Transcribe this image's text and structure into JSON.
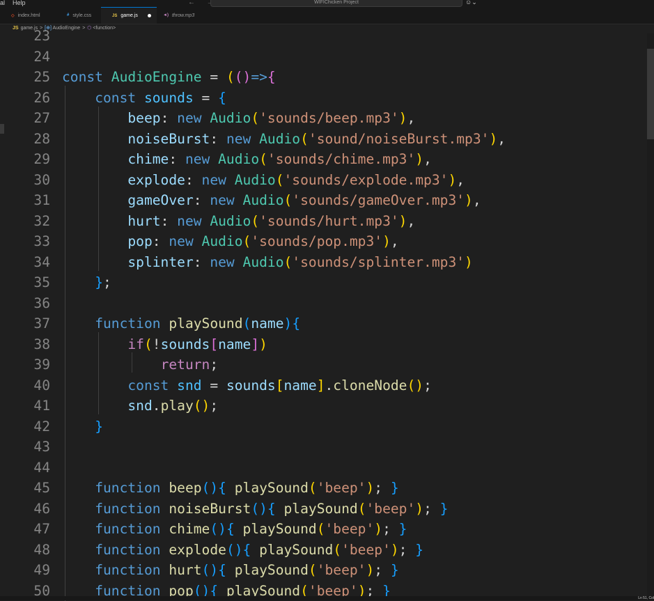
{
  "menubar": {
    "items": [
      "al",
      "Help"
    ],
    "back": "←",
    "forward": "→"
  },
  "command_center": {
    "label": "WIFIChicken Project"
  },
  "tabs": [
    {
      "icon": "html-icon",
      "icon_glyph": "◇",
      "label": "index.html",
      "color": "#e44d26",
      "active": false
    },
    {
      "icon": "css-icon",
      "icon_glyph": "#",
      "label": "style.css",
      "color": "#42a5f5",
      "active": false
    },
    {
      "icon": "js-icon",
      "icon_glyph": "JS",
      "label": "game.js",
      "color": "#e8c64a",
      "active": true,
      "modified": true
    },
    {
      "icon": "audio-icon",
      "icon_glyph": "◄)",
      "label": "throw.mp3",
      "color": "#c586c0",
      "active": false
    }
  ],
  "breadcrumb": {
    "file": "game.js",
    "symbol": "AudioEngine",
    "scope": "<function>"
  },
  "editor": {
    "lines": [
      {
        "n": "23",
        "t": []
      },
      {
        "n": "24",
        "t": []
      },
      {
        "n": "25",
        "t": [
          [
            "k",
            "const "
          ],
          [
            "cls",
            "AudioEngine "
          ],
          [
            "p",
            "= "
          ],
          [
            "b1",
            "("
          ],
          [
            "b2",
            "("
          ],
          [
            "b2",
            ")"
          ],
          [
            "k",
            "=>"
          ],
          [
            "b2",
            "{"
          ]
        ]
      },
      {
        "n": "26",
        "t": [
          [
            "p",
            "    "
          ],
          [
            "k",
            "const "
          ],
          [
            "o",
            "sounds "
          ],
          [
            "p",
            "= "
          ],
          [
            "b3",
            "{"
          ]
        ]
      },
      {
        "n": "27",
        "t": [
          [
            "p",
            "        "
          ],
          [
            "v",
            "beep"
          ],
          [
            "p",
            ": "
          ],
          [
            "k",
            "new "
          ],
          [
            "cls",
            "Audio"
          ],
          [
            "b1",
            "("
          ],
          [
            "s",
            "'sounds/beep.mp3'"
          ],
          [
            "b1",
            ")"
          ],
          [
            "p",
            ","
          ]
        ]
      },
      {
        "n": "28",
        "t": [
          [
            "p",
            "        "
          ],
          [
            "v",
            "noiseBurst"
          ],
          [
            "p",
            ": "
          ],
          [
            "k",
            "new "
          ],
          [
            "cls",
            "Audio"
          ],
          [
            "b1",
            "("
          ],
          [
            "s",
            "'sound/noiseBurst.mp3'"
          ],
          [
            "b1",
            ")"
          ],
          [
            "p",
            ","
          ]
        ]
      },
      {
        "n": "29",
        "t": [
          [
            "p",
            "        "
          ],
          [
            "v",
            "chime"
          ],
          [
            "p",
            ": "
          ],
          [
            "k",
            "new "
          ],
          [
            "cls",
            "Audio"
          ],
          [
            "b1",
            "("
          ],
          [
            "s",
            "'sounds/chime.mp3'"
          ],
          [
            "b1",
            ")"
          ],
          [
            "p",
            ","
          ]
        ]
      },
      {
        "n": "30",
        "t": [
          [
            "p",
            "        "
          ],
          [
            "v",
            "explode"
          ],
          [
            "p",
            ": "
          ],
          [
            "k",
            "new "
          ],
          [
            "cls",
            "Audio"
          ],
          [
            "b1",
            "("
          ],
          [
            "s",
            "'sounds/explode.mp3'"
          ],
          [
            "b1",
            ")"
          ],
          [
            "p",
            ","
          ]
        ]
      },
      {
        "n": "31",
        "t": [
          [
            "p",
            "        "
          ],
          [
            "v",
            "gameOver"
          ],
          [
            "p",
            ": "
          ],
          [
            "k",
            "new "
          ],
          [
            "cls",
            "Audio"
          ],
          [
            "b1",
            "("
          ],
          [
            "s",
            "'sounds/gameOver.mp3'"
          ],
          [
            "b1",
            ")"
          ],
          [
            "p",
            ","
          ]
        ]
      },
      {
        "n": "32",
        "t": [
          [
            "p",
            "        "
          ],
          [
            "v",
            "hurt"
          ],
          [
            "p",
            ": "
          ],
          [
            "k",
            "new "
          ],
          [
            "cls",
            "Audio"
          ],
          [
            "b1",
            "("
          ],
          [
            "s",
            "'sounds/hurt.mp3'"
          ],
          [
            "b1",
            ")"
          ],
          [
            "p",
            ","
          ]
        ]
      },
      {
        "n": "33",
        "t": [
          [
            "p",
            "        "
          ],
          [
            "v",
            "pop"
          ],
          [
            "p",
            ": "
          ],
          [
            "k",
            "new "
          ],
          [
            "cls",
            "Audio"
          ],
          [
            "b1",
            "("
          ],
          [
            "s",
            "'sounds/pop.mp3'"
          ],
          [
            "b1",
            ")"
          ],
          [
            "p",
            ","
          ]
        ]
      },
      {
        "n": "34",
        "t": [
          [
            "p",
            "        "
          ],
          [
            "v",
            "splinter"
          ],
          [
            "p",
            ": "
          ],
          [
            "k",
            "new "
          ],
          [
            "cls",
            "Audio"
          ],
          [
            "b1",
            "("
          ],
          [
            "s",
            "'sounds/splinter.mp3'"
          ],
          [
            "b1",
            ")"
          ]
        ]
      },
      {
        "n": "35",
        "t": [
          [
            "p",
            "    "
          ],
          [
            "b3",
            "}"
          ],
          [
            "p",
            ";"
          ]
        ]
      },
      {
        "n": "36",
        "t": []
      },
      {
        "n": "37",
        "t": [
          [
            "p",
            "    "
          ],
          [
            "k",
            "function "
          ],
          [
            "f",
            "playSound"
          ],
          [
            "b3",
            "("
          ],
          [
            "v",
            "name"
          ],
          [
            "b3",
            ")"
          ],
          [
            "b3",
            "{"
          ]
        ]
      },
      {
        "n": "38",
        "t": [
          [
            "p",
            "        "
          ],
          [
            "c",
            "if"
          ],
          [
            "b1",
            "("
          ],
          [
            "p",
            "!"
          ],
          [
            "v",
            "sounds"
          ],
          [
            "b2",
            "["
          ],
          [
            "v",
            "name"
          ],
          [
            "b2",
            "]"
          ],
          [
            "b1",
            ")"
          ]
        ]
      },
      {
        "n": "39",
        "t": [
          [
            "p",
            "            "
          ],
          [
            "c",
            "return"
          ],
          [
            "p",
            ";"
          ]
        ]
      },
      {
        "n": "40",
        "t": [
          [
            "p",
            "        "
          ],
          [
            "k",
            "const "
          ],
          [
            "o",
            "snd "
          ],
          [
            "p",
            "= "
          ],
          [
            "v",
            "sounds"
          ],
          [
            "b1",
            "["
          ],
          [
            "v",
            "name"
          ],
          [
            "b1",
            "]"
          ],
          [
            "p",
            "."
          ],
          [
            "f",
            "cloneNode"
          ],
          [
            "b1",
            "("
          ],
          [
            "b1",
            ")"
          ],
          [
            "p",
            ";"
          ]
        ]
      },
      {
        "n": "41",
        "t": [
          [
            "p",
            "        "
          ],
          [
            "v",
            "snd"
          ],
          [
            "p",
            "."
          ],
          [
            "f",
            "play"
          ],
          [
            "b1",
            "("
          ],
          [
            "b1",
            ")"
          ],
          [
            "p",
            ";"
          ]
        ]
      },
      {
        "n": "42",
        "t": [
          [
            "p",
            "    "
          ],
          [
            "b3",
            "}"
          ]
        ]
      },
      {
        "n": "43",
        "t": []
      },
      {
        "n": "44",
        "t": []
      },
      {
        "n": "45",
        "t": [
          [
            "p",
            "    "
          ],
          [
            "k",
            "function "
          ],
          [
            "f",
            "beep"
          ],
          [
            "b3",
            "("
          ],
          [
            "b3",
            ")"
          ],
          [
            "b3",
            "{ "
          ],
          [
            "f",
            "playSound"
          ],
          [
            "b1",
            "("
          ],
          [
            "s",
            "'beep'"
          ],
          [
            "b1",
            ")"
          ],
          [
            "p",
            "; "
          ],
          [
            "b3",
            "}"
          ]
        ]
      },
      {
        "n": "46",
        "t": [
          [
            "p",
            "    "
          ],
          [
            "k",
            "function "
          ],
          [
            "f",
            "noiseBurst"
          ],
          [
            "b3",
            "("
          ],
          [
            "b3",
            ")"
          ],
          [
            "b3",
            "{ "
          ],
          [
            "f",
            "playSound"
          ],
          [
            "b1",
            "("
          ],
          [
            "s",
            "'beep'"
          ],
          [
            "b1",
            ")"
          ],
          [
            "p",
            "; "
          ],
          [
            "b3",
            "}"
          ]
        ]
      },
      {
        "n": "47",
        "t": [
          [
            "p",
            "    "
          ],
          [
            "k",
            "function "
          ],
          [
            "f",
            "chime"
          ],
          [
            "b3",
            "("
          ],
          [
            "b3",
            ")"
          ],
          [
            "b3",
            "{ "
          ],
          [
            "f",
            "playSound"
          ],
          [
            "b1",
            "("
          ],
          [
            "s",
            "'beep'"
          ],
          [
            "b1",
            ")"
          ],
          [
            "p",
            "; "
          ],
          [
            "b3",
            "}"
          ]
        ]
      },
      {
        "n": "48",
        "t": [
          [
            "p",
            "    "
          ],
          [
            "k",
            "function "
          ],
          [
            "f",
            "explode"
          ],
          [
            "b3",
            "("
          ],
          [
            "b3",
            ")"
          ],
          [
            "b3",
            "{ "
          ],
          [
            "f",
            "playSound"
          ],
          [
            "b1",
            "("
          ],
          [
            "s",
            "'beep'"
          ],
          [
            "b1",
            ")"
          ],
          [
            "p",
            "; "
          ],
          [
            "b3",
            "}"
          ]
        ]
      },
      {
        "n": "49",
        "t": [
          [
            "p",
            "    "
          ],
          [
            "k",
            "function "
          ],
          [
            "f",
            "hurt"
          ],
          [
            "b3",
            "("
          ],
          [
            "b3",
            ")"
          ],
          [
            "b3",
            "{ "
          ],
          [
            "f",
            "playSound"
          ],
          [
            "b1",
            "("
          ],
          [
            "s",
            "'beep'"
          ],
          [
            "b1",
            ")"
          ],
          [
            "p",
            "; "
          ],
          [
            "b3",
            "}"
          ]
        ]
      },
      {
        "n": "50",
        "t": [
          [
            "p",
            "    "
          ],
          [
            "k",
            "function "
          ],
          [
            "f",
            "pop"
          ],
          [
            "b3",
            "("
          ],
          [
            "b3",
            ")"
          ],
          [
            "b3",
            "{ "
          ],
          [
            "f",
            "playSound"
          ],
          [
            "b1",
            "("
          ],
          [
            "s",
            "'beep'"
          ],
          [
            "b1",
            ")"
          ],
          [
            "p",
            "; "
          ],
          [
            "b3",
            "}"
          ]
        ]
      }
    ]
  },
  "statusbar": {
    "position": "Ln 51, Col"
  }
}
